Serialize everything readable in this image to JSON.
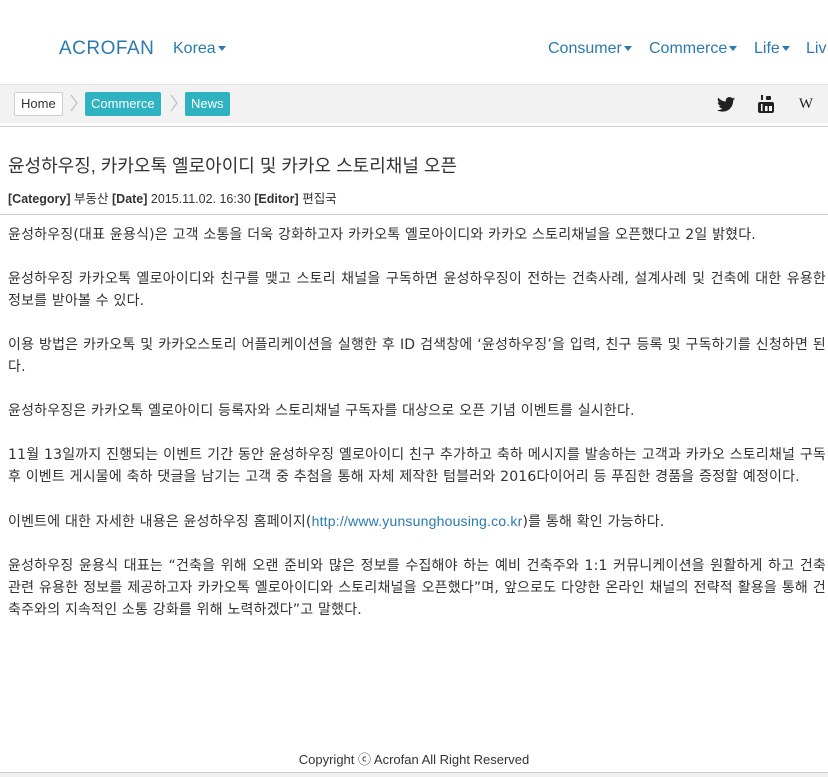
{
  "nav": {
    "brand": "ACROFAN",
    "region": "Korea",
    "menus": [
      "Consumer",
      "Commerce",
      "Life",
      "Liv"
    ]
  },
  "breadcrumb": {
    "home": "Home",
    "items": [
      "Commerce",
      "News"
    ]
  },
  "social": {
    "icons": [
      "twitter-icon",
      "youtube-icon",
      "wikipedia-icon"
    ],
    "wikipedia_glyph": "W"
  },
  "article": {
    "title": "윤성하우징, 카카오톡 옐로아이디 및 카카오 스토리채널 오픈",
    "meta": {
      "category_label": "[Category]",
      "category": "부동산",
      "date_label": "[Date]",
      "date": "2015.11.02. 16:30",
      "editor_label": "[Editor]",
      "editor": "편집국"
    },
    "paragraphs": [
      "윤성하우징(대표 윤용식)은 고객 소통을 더욱 강화하고자 카카오톡 옐로아이디와 카카오 스토리채널을 오픈했다고 2일 밝혔다.",
      "윤성하우징 카카오톡 옐로아이디와 친구를 맺고 스토리 채널을 구독하면 윤성하우징이 전하는 건축사례, 설계사례 및 건축에 대한 유용한 정보를 받아볼 수 있다.",
      "이용 방법은 카카오톡 및 카카오스토리 어플리케이션을 실행한 후 ID 검색창에 ‘윤성하우징’을 입력, 친구 등록 및 구독하기를 신청하면 된다.",
      "윤성하우징은 카카오톡 옐로아이디 등록자와 스토리채널 구독자를 대상으로 오픈 기념 이벤트를 실시한다.",
      "11월 13일까지 진행되는 이벤트 기간 동안 윤성하우징 옐로아이디 친구 추가하고 축하 메시지를 발송하는 고객과 카카오 스토리채널 구독 후 이벤트 게시물에 축하 댓글을 남기는 고객 중 추첨을 통해 자체 제작한 텀블러와 2016다이어리 등 푸짐한 경품을 증정할 예정이다."
    ],
    "link_paragraph": {
      "before": "이벤트에 대한 자세한 내용은 윤성하우징 홈페이지(",
      "link": "http://www.yunsunghousing.co.kr",
      "after": ")를 통해 확인 가능하다."
    },
    "quote_paragraph": "윤성하우징 윤용식 대표는 “건축을 위해 오랜 준비와 많은 정보를 수집해야 하는 예비 건축주와 1:1 커뮤니케이션을 원활하게 하고 건축 관련 유용한 정보를 제공하고자 카카오톡 옐로아이디와 스토리채널을 오픈했다”며, 앞으로도 다양한 온라인 채널의 전략적 활용을 통해 건축주와의 지속적인 소통 강화를 위해 노력하겠다”고 말했다."
  },
  "footer": {
    "copyright": "Copyright ⓒ Acrofan All Right Reserved"
  },
  "colors": {
    "brand": "#2a7ab0",
    "pill": "#2fb3c2"
  }
}
